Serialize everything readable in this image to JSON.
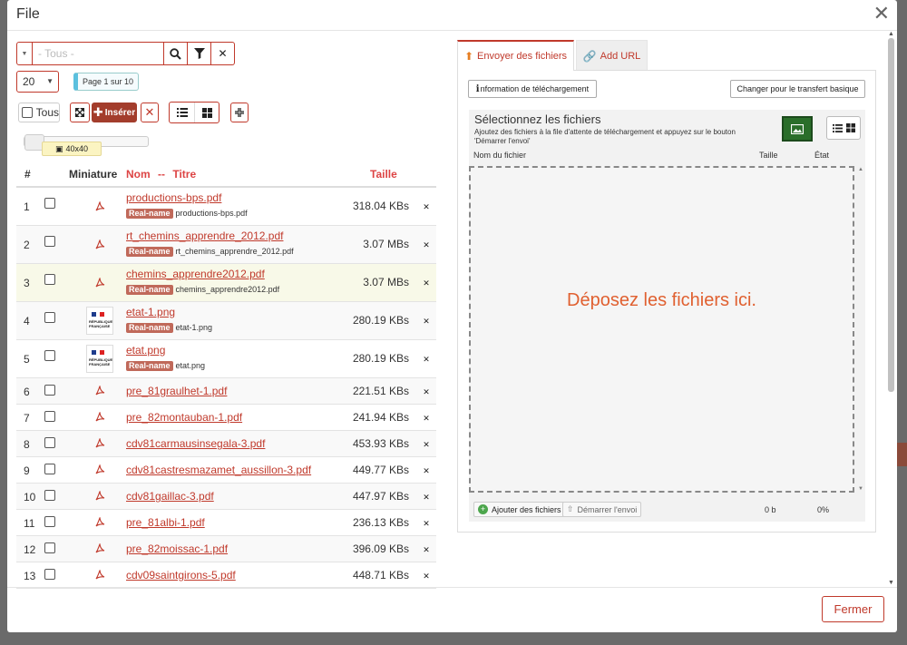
{
  "dialog": {
    "title": "File",
    "close_symbol": "✕",
    "footer_button": "Fermer"
  },
  "search": {
    "placeholder": "- Tous -",
    "dropdown_symbol": "▼",
    "search_icon": "search-icon",
    "filter_icon": "filter-icon",
    "clear_symbol": "✕"
  },
  "pagination": {
    "page_size": "20",
    "page_label": "Page 1 sur 10"
  },
  "toolbar": {
    "all_label": "Tous",
    "insert_label": "Insérer",
    "remove_symbol": "✕"
  },
  "thumb_slider": {
    "label": "40x40",
    "level": 0
  },
  "table": {
    "headers": {
      "number": "#",
      "thumbnail": "Miniature",
      "name": "Nom",
      "separator": "--",
      "title": "Titre",
      "size": "Taille"
    },
    "real_name_badge": "Real-name",
    "delete_symbol": "✕",
    "rows": [
      {
        "num": "1",
        "name": "productions-bps.pdf",
        "real_name": "productions-bps.pdf",
        "size": "318.04 KBs",
        "thumb": "pdf"
      },
      {
        "num": "2",
        "name": "rt_chemins_apprendre_2012.pdf",
        "real_name": "rt_chemins_apprendre_2012.pdf",
        "size": "3.07 MBs",
        "thumb": "pdf"
      },
      {
        "num": "3",
        "name": "chemins_apprendre2012.pdf",
        "real_name": "chemins_apprendre2012.pdf",
        "size": "3.07 MBs",
        "thumb": "pdf"
      },
      {
        "num": "4",
        "name": "etat-1.png",
        "real_name": "etat-1.png",
        "size": "280.19 KBs",
        "thumb": "image"
      },
      {
        "num": "5",
        "name": "etat.png",
        "real_name": "etat.png",
        "size": "280.19 KBs",
        "thumb": "image"
      },
      {
        "num": "6",
        "name": "pre_81graulhet-1.pdf",
        "size": "221.51 KBs",
        "thumb": "pdf"
      },
      {
        "num": "7",
        "name": "pre_82montauban-1.pdf",
        "size": "241.94 KBs",
        "thumb": "pdf"
      },
      {
        "num": "8",
        "name": "cdv81carmausinsegala-3.pdf",
        "size": "453.93 KBs",
        "thumb": "pdf"
      },
      {
        "num": "9",
        "name": "cdv81castresmazamet_aussillon-3.pdf",
        "size": "449.77 KBs",
        "thumb": "pdf"
      },
      {
        "num": "10",
        "name": "cdv81gaillac-3.pdf",
        "size": "447.97 KBs",
        "thumb": "pdf"
      },
      {
        "num": "11",
        "name": "pre_81albi-1.pdf",
        "size": "236.13 KBs",
        "thumb": "pdf"
      },
      {
        "num": "12",
        "name": "pre_82moissac-1.pdf",
        "size": "396.09 KBs",
        "thumb": "pdf"
      },
      {
        "num": "13",
        "name": "cdv09saintgirons-5.pdf",
        "size": "448.71 KBs",
        "thumb": "pdf"
      }
    ],
    "thumb_image_text": "RÉPUBLIQUE FRANÇAISE"
  },
  "tabs": {
    "upload": "Envoyer des fichiers",
    "add_url": "Add URL"
  },
  "upload": {
    "info_button": "nformation de téléchargement",
    "info_glyph": "i",
    "switch_button": "Changer pour le transfert basique",
    "title": "Sélectionnez les fichiers",
    "subtitle": "Ajoutez des fichiers à la file d'attente de téléchargement et appuyez sur le bouton 'Démarrer l'envoi'",
    "col_filename": "Nom du fichier",
    "col_size": "Taille",
    "col_status": "État",
    "drop_text": "Déposez les fichiers ici.",
    "add_button": "Ajouter des fichiers",
    "start_button": "Démarrer l'envoi",
    "total_size": "0 b",
    "progress": "0%"
  },
  "colors": {
    "accent": "#c0392b",
    "insert_bg": "#a33d2c",
    "drop_text": "#e06030",
    "image_button": "#2a6e2a"
  }
}
